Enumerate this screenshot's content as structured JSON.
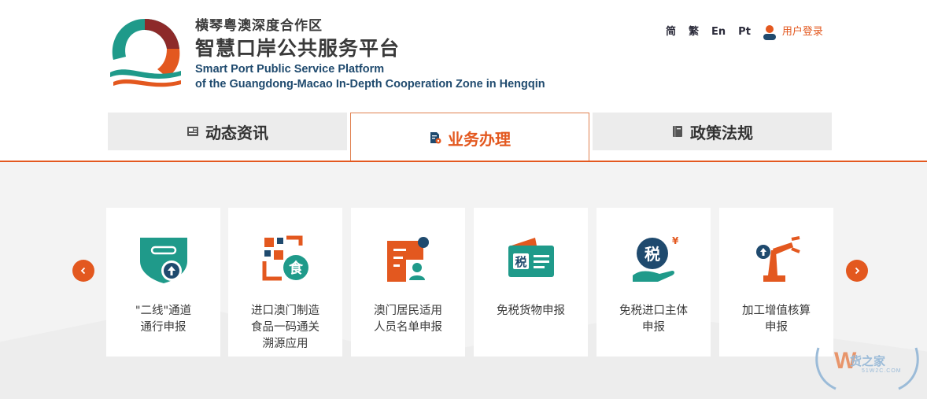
{
  "header": {
    "title_cn_small": "横琴粤澳深度合作区",
    "title_cn_large": "智慧口岸公共服务平台",
    "title_en_line1": "Smart Port Public Service Platform",
    "title_en_line2": "of the Guangdong-Macao In-Depth Cooperation Zone in Hengqin",
    "languages": [
      "简",
      "繁",
      "En",
      "Pt"
    ],
    "login_label": "用户登录"
  },
  "tabs": [
    {
      "label": "动态资讯",
      "icon": "newspaper-icon",
      "active": false
    },
    {
      "label": "业务办理",
      "icon": "document-gear-icon",
      "active": true
    },
    {
      "label": "政策法规",
      "icon": "book-icon",
      "active": false
    }
  ],
  "services": [
    {
      "line1": "\"二线\"通道",
      "line2": "通行申报",
      "line3": "",
      "icon": "shield-upload-icon"
    },
    {
      "line1": "进口澳门制造",
      "line2": "食品一码通关",
      "line3": "溯源应用",
      "icon": "food-qrcode-icon"
    },
    {
      "line1": "澳门居民适用",
      "line2": "人员名单申报",
      "line3": "",
      "icon": "person-list-icon"
    },
    {
      "line1": "免税货物申报",
      "line2": "",
      "line3": "",
      "icon": "tax-card-icon"
    },
    {
      "line1": "免税进口主体",
      "line2": "申报",
      "line3": "",
      "icon": "tax-hand-icon"
    },
    {
      "line1": "加工增值核算",
      "line2": "申报",
      "line3": "",
      "icon": "robot-arm-icon"
    }
  ],
  "icon_glyphs": {
    "tax": "税",
    "food": "食",
    "yen": "¥"
  },
  "watermark": {
    "text": "货之家",
    "sub": "51W2C.COM"
  },
  "colors": {
    "accent": "#e3581f",
    "teal": "#1f9a8a",
    "navy": "#1f4a6e"
  }
}
